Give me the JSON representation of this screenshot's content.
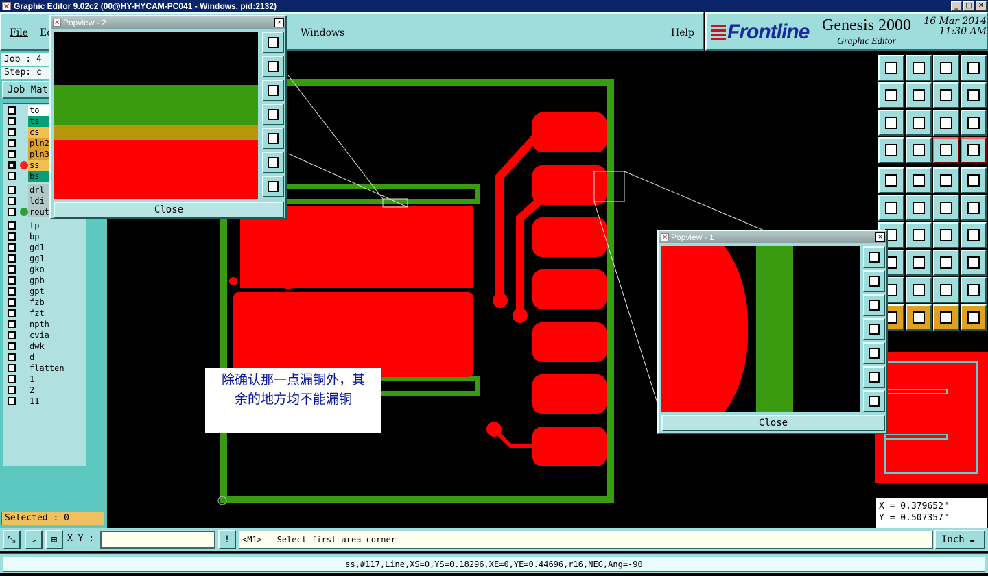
{
  "window": {
    "title": "Graphic Editor 9.02c2 (00@HY-HYCAM-PC041 - Windows, pid:2132)",
    "buttons": [
      "_",
      "□",
      "✕"
    ]
  },
  "menu": {
    "file": "File",
    "edit": "Ed",
    "windows": "Windows",
    "help": "Help"
  },
  "brand": {
    "logo": "Frontline",
    "product": "Genesis 2000",
    "subtitle": "Graphic Editor",
    "date": "16 Mar 2014",
    "time": "11:30 AM"
  },
  "left": {
    "job": "Job : 4",
    "step": "Step: c",
    "job_matrix": "Job Mat",
    "layers": [
      {
        "name": "to",
        "color": "#ffffff",
        "dot": "",
        "checked": false
      },
      {
        "name": "ts",
        "color": "#00a078",
        "dot": "",
        "checked": false
      },
      {
        "name": "cs",
        "color": "#f0c050",
        "dot": "",
        "checked": false
      },
      {
        "name": "pln2",
        "color": "#e0a030",
        "dot": "",
        "checked": false
      },
      {
        "name": "pln3",
        "color": "#e0a030",
        "dot": "",
        "checked": false
      },
      {
        "name": "ss",
        "color": "#f0c050",
        "dot": "#ff2020",
        "checked": true
      },
      {
        "name": "bs",
        "color": "#00a078",
        "dot": "",
        "checked": false
      },
      {
        "name": "drl",
        "color": "#b0c8c8",
        "dot": "",
        "checked": false
      },
      {
        "name": "ldi",
        "color": "#b0c8c8",
        "dot": "",
        "checked": false
      },
      {
        "name": "rout",
        "color": "#b0c8c8",
        "dot": "#30a030",
        "checked": false
      },
      {
        "name": "tp",
        "color": "#b0e0e0",
        "dot": "",
        "checked": false
      },
      {
        "name": "bp",
        "color": "#b0e0e0",
        "dot": "",
        "checked": false
      },
      {
        "name": "gd1",
        "color": "#b0e0e0",
        "dot": "",
        "checked": false
      },
      {
        "name": "gg1",
        "color": "#b0e0e0",
        "dot": "",
        "checked": false
      },
      {
        "name": "gko",
        "color": "#b0e0e0",
        "dot": "",
        "checked": false
      },
      {
        "name": "gpb",
        "color": "#b0e0e0",
        "dot": "",
        "checked": false
      },
      {
        "name": "gpt",
        "color": "#b0e0e0",
        "dot": "",
        "checked": false
      },
      {
        "name": "fzb",
        "color": "#b0e0e0",
        "dot": "",
        "checked": false
      },
      {
        "name": "fzt",
        "color": "#b0e0e0",
        "dot": "",
        "checked": false
      },
      {
        "name": "npth",
        "color": "#b0e0e0",
        "dot": "",
        "checked": false
      },
      {
        "name": "cvia",
        "color": "#b0e0e0",
        "dot": "",
        "checked": false
      },
      {
        "name": "dwk",
        "color": "#b0e0e0",
        "dot": "",
        "checked": false
      },
      {
        "name": "d",
        "color": "#b0e0e0",
        "dot": "",
        "checked": false
      },
      {
        "name": "flatten",
        "color": "#b0e0e0",
        "dot": "",
        "checked": false
      },
      {
        "name": "1",
        "color": "#b0e0e0",
        "dot": "",
        "checked": false
      },
      {
        "name": "2",
        "color": "#b0e0e0",
        "dot": "",
        "checked": false
      },
      {
        "name": "11",
        "color": "#b0e0e0",
        "dot": "",
        "checked": false
      }
    ],
    "selected": "Selected : 0"
  },
  "popview2": {
    "title": "Popview - 2",
    "close": "Close",
    "close_x": "✕"
  },
  "popview1": {
    "title": "Popview - 1",
    "close": "Close",
    "close_x": "✕"
  },
  "note": {
    "line1": "除确认那一点漏铜外，其",
    "line2": "余的地方均不能漏铜"
  },
  "coords": {
    "x": "X = 0.379652\"",
    "y": "Y = 0.507357\""
  },
  "bottom": {
    "xy_label": "X Y :",
    "xy_value": "",
    "message": "<M1> - Select first area corner",
    "units": "Inch",
    "units_arrow": "▬"
  },
  "status": {
    "text": "ss,#117,Line,XS=0,YS=0.18296,XE=0,YE=0.44696,r16,NEG,Ang=-90"
  },
  "colors": {
    "copper": "#ff0000",
    "outline": "#3a9a10",
    "panel": "#9fdcdc"
  }
}
